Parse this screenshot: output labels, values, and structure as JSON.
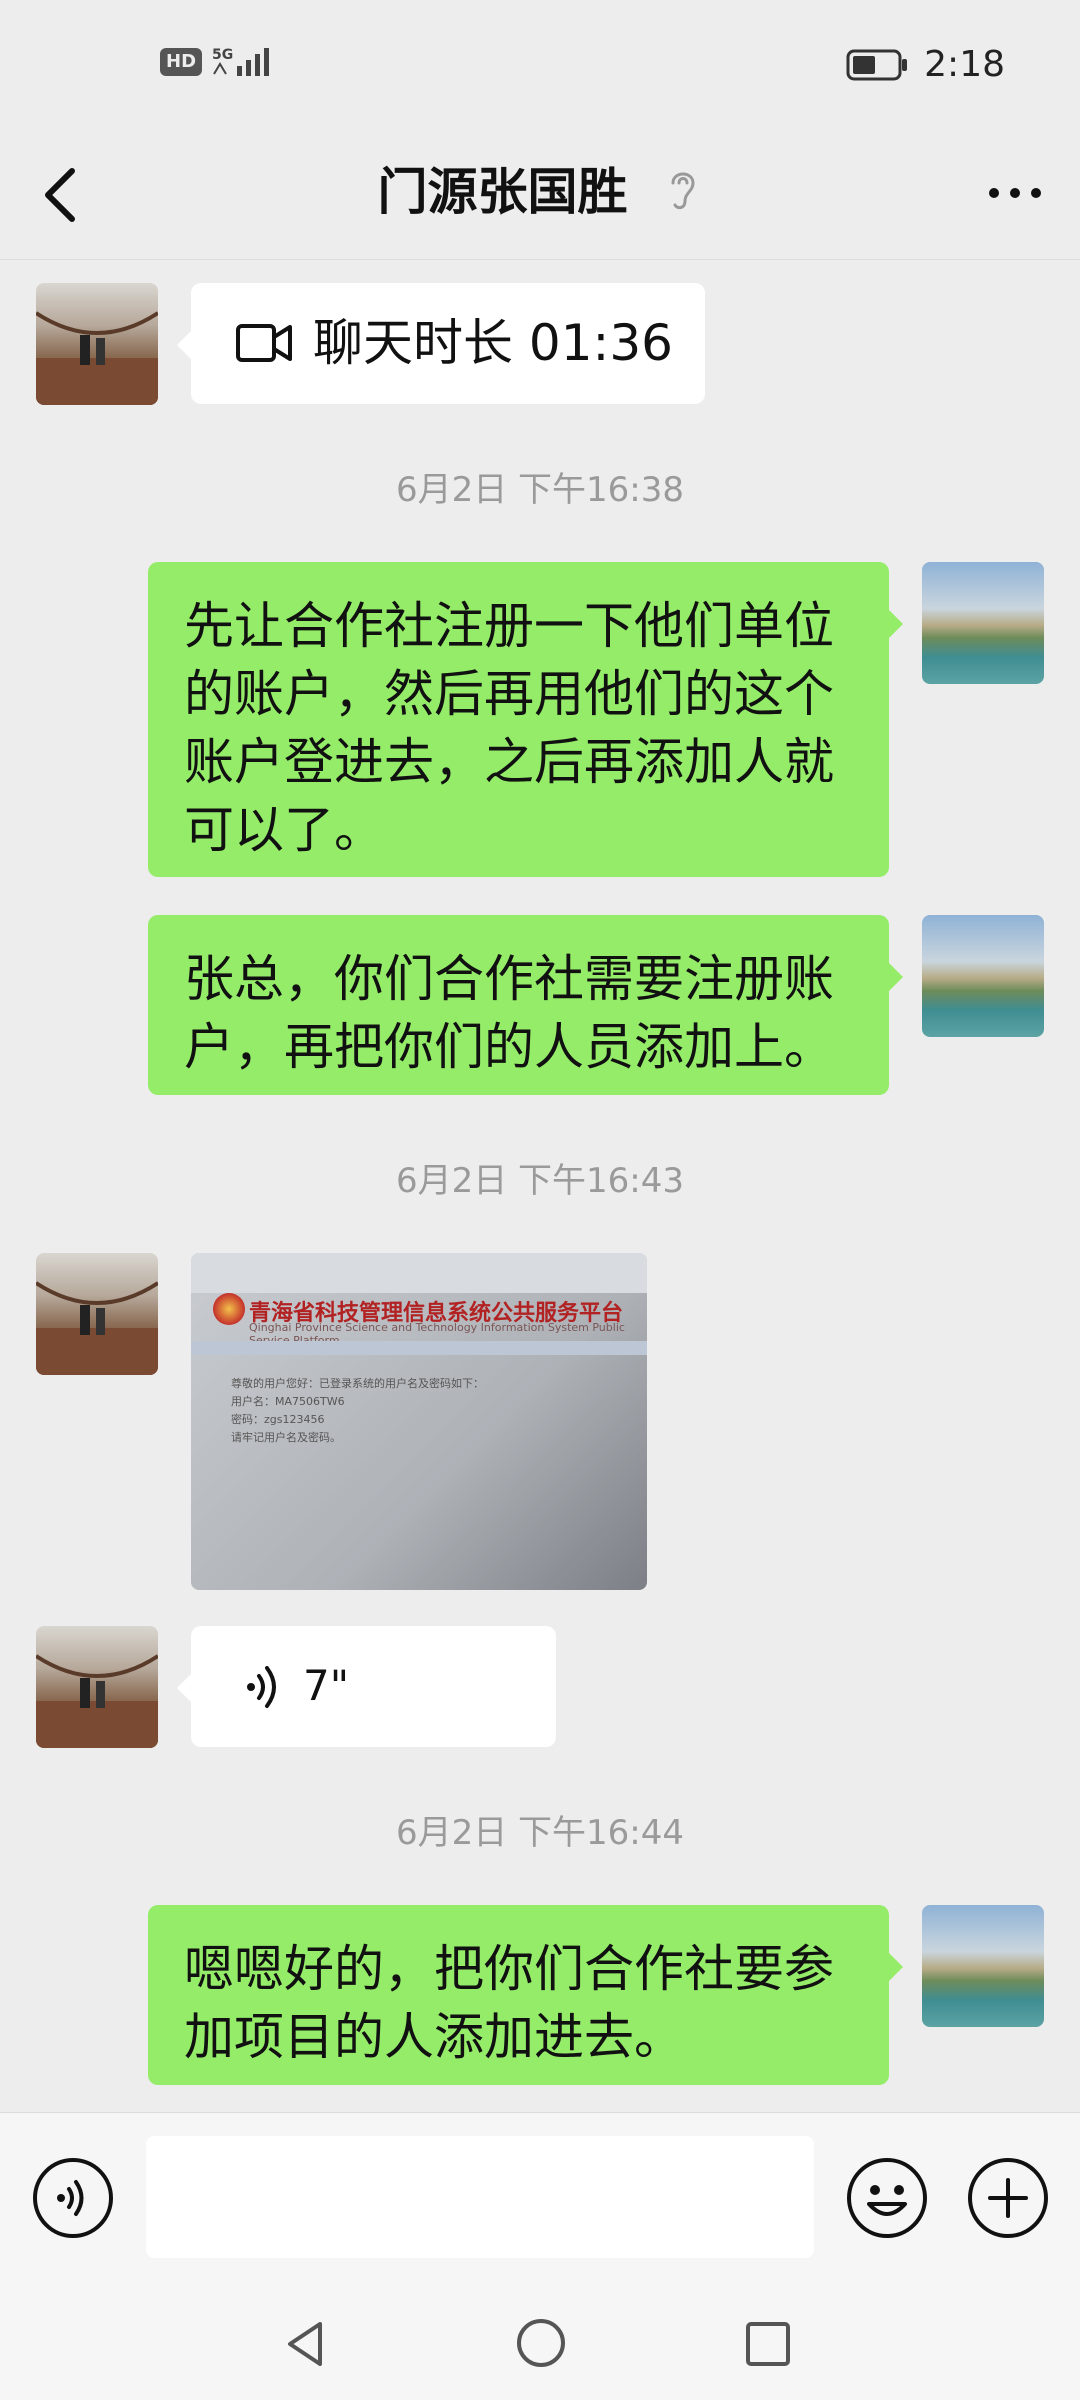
{
  "status_bar": {
    "hd_badge": "HD",
    "network": "5G",
    "time": "2:18"
  },
  "header": {
    "back_icon": "back-chevron-icon",
    "title": "门源张国胜",
    "ear_icon": "earpiece-mode-icon",
    "more_icon": "more-icon"
  },
  "messages": {
    "video_call_duration": "聊天时长 01:36",
    "ts1": "6月2日 下午16:38",
    "msg1": "先让合作社注册一下他们单位的账户，然后再用他们的这个账户登进去，之后再添加人就可以了。",
    "msg2": "张总，你们合作社需要注册账户，再把你们的人员添加上。",
    "ts2": "6月2日 下午16:43",
    "image_title": "青海省科技管理信息系统公共服务平台",
    "image_subtitle": "Qinghai Province Science and Technology Information System Public Service Platform",
    "image_lines": [
      "尊敬的用户您好：已登录系统的用户名及密码如下：",
      "用户名：MA7506TW6",
      "密码：zgs123456",
      "请牢记用户名及密码。"
    ],
    "voice_duration": "7\"",
    "ts3": "6月2日 下午16:44",
    "msg3": "嗯嗯好的，把你们合作社要参加项目的人添加进去。"
  },
  "input_bar": {
    "voice_icon": "voice-input-icon",
    "emoji_icon": "emoji-icon",
    "plus_icon": "plus-icon",
    "input_value": ""
  },
  "system_nav": {
    "back": "triangle-back-icon",
    "home": "circle-home-icon",
    "recent": "square-recent-icon"
  },
  "colors": {
    "self_bubble": "#95ec69",
    "other_bubble": "#ffffff",
    "background": "#ededed"
  }
}
